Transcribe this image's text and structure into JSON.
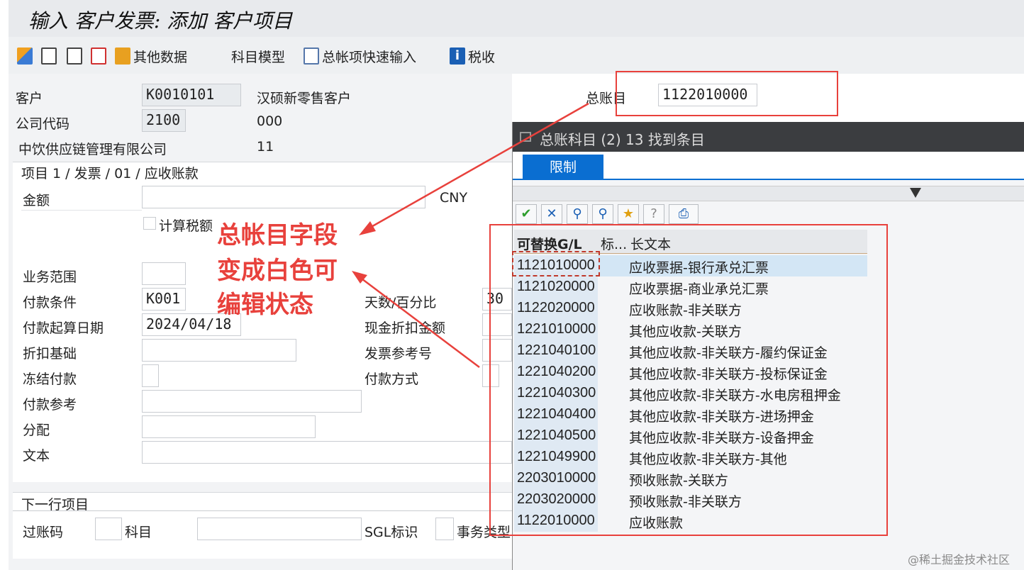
{
  "window_title": "输入 客户发票: 添加 客户项目",
  "toolbar": {
    "other_data": "其他数据",
    "account_model": "科目模型",
    "gl_fast_entry": "总帐项快速输入",
    "tax": "税收"
  },
  "header": {
    "customer_label": "客户",
    "customer_value": "K0010101",
    "customer_name": "汉硕新零售客户",
    "company_code_label": "公司代码",
    "company_code_value": "2100",
    "company_code_extra": "000",
    "company_name": "中饮供应链管理有限公司",
    "company_name_extra": "11",
    "gl_account_label": "总账目",
    "gl_account_value": "1122010000"
  },
  "item_panel": {
    "title": "项目 1 / 发票 / 01 / 应收账款",
    "amount_label": "金额",
    "currency": "CNY",
    "calc_tax_label": "计算税额",
    "business_area_label": "业务范围",
    "payment_terms_label": "付款条件",
    "payment_terms_value": "K001",
    "days_percent_label": "天数/百分比",
    "days_percent_value": "30",
    "baseline_date_label": "付款起算日期",
    "baseline_date_value": "2024/04/18",
    "cash_discount_label": "现金折扣金额",
    "discount_base_label": "折扣基础",
    "invoice_ref_label": "发票参考号",
    "payment_block_label": "冻结付款",
    "payment_method_label": "付款方式",
    "payment_ref_label": "付款参考",
    "assignment_label": "分配",
    "text_label": "文本"
  },
  "next_line_panel": {
    "title": "下一行项目",
    "posting_key_label": "过账码",
    "account_label": "科目",
    "sgl_label": "SGL标识",
    "transaction_type_label": "事务类型"
  },
  "popup": {
    "title": "总账科目 (2)   13 找到条目",
    "tab_label": "限制",
    "col_gl": "可替换G/L",
    "col_flag": "标...",
    "col_long_text": "长文本",
    "rows": [
      {
        "gl": "1121010000",
        "text": "应收票据-银行承兑汇票"
      },
      {
        "gl": "1121020000",
        "text": "应收票据-商业承兑汇票"
      },
      {
        "gl": "1122020000",
        "text": "应收账款-非关联方"
      },
      {
        "gl": "1221010000",
        "text": "其他应收款-关联方"
      },
      {
        "gl": "1221040100",
        "text": "其他应收款-非关联方-履约保证金"
      },
      {
        "gl": "1221040200",
        "text": "其他应收款-非关联方-投标保证金"
      },
      {
        "gl": "1221040300",
        "text": "其他应收款-非关联方-水电房租押金"
      },
      {
        "gl": "1221040400",
        "text": "其他应收款-非关联方-进场押金"
      },
      {
        "gl": "1221040500",
        "text": "其他应收款-非关联方-设备押金"
      },
      {
        "gl": "1221049900",
        "text": "其他应收款-非关联方-其他"
      },
      {
        "gl": "2203010000",
        "text": "预收账款-关联方"
      },
      {
        "gl": "2203020000",
        "text": "预收账款-非关联方"
      },
      {
        "gl": "1122010000",
        "text": "应收账款"
      }
    ]
  },
  "annotation": {
    "line1": "总帐目字段",
    "line2": "变成白色可",
    "line3": "编辑状态"
  },
  "watermark": "@稀土掘金技术社区",
  "colors": {
    "accent_blue": "#0a6ed1",
    "annotation_red": "#e8413c",
    "popup_header": "#3b3d40"
  }
}
